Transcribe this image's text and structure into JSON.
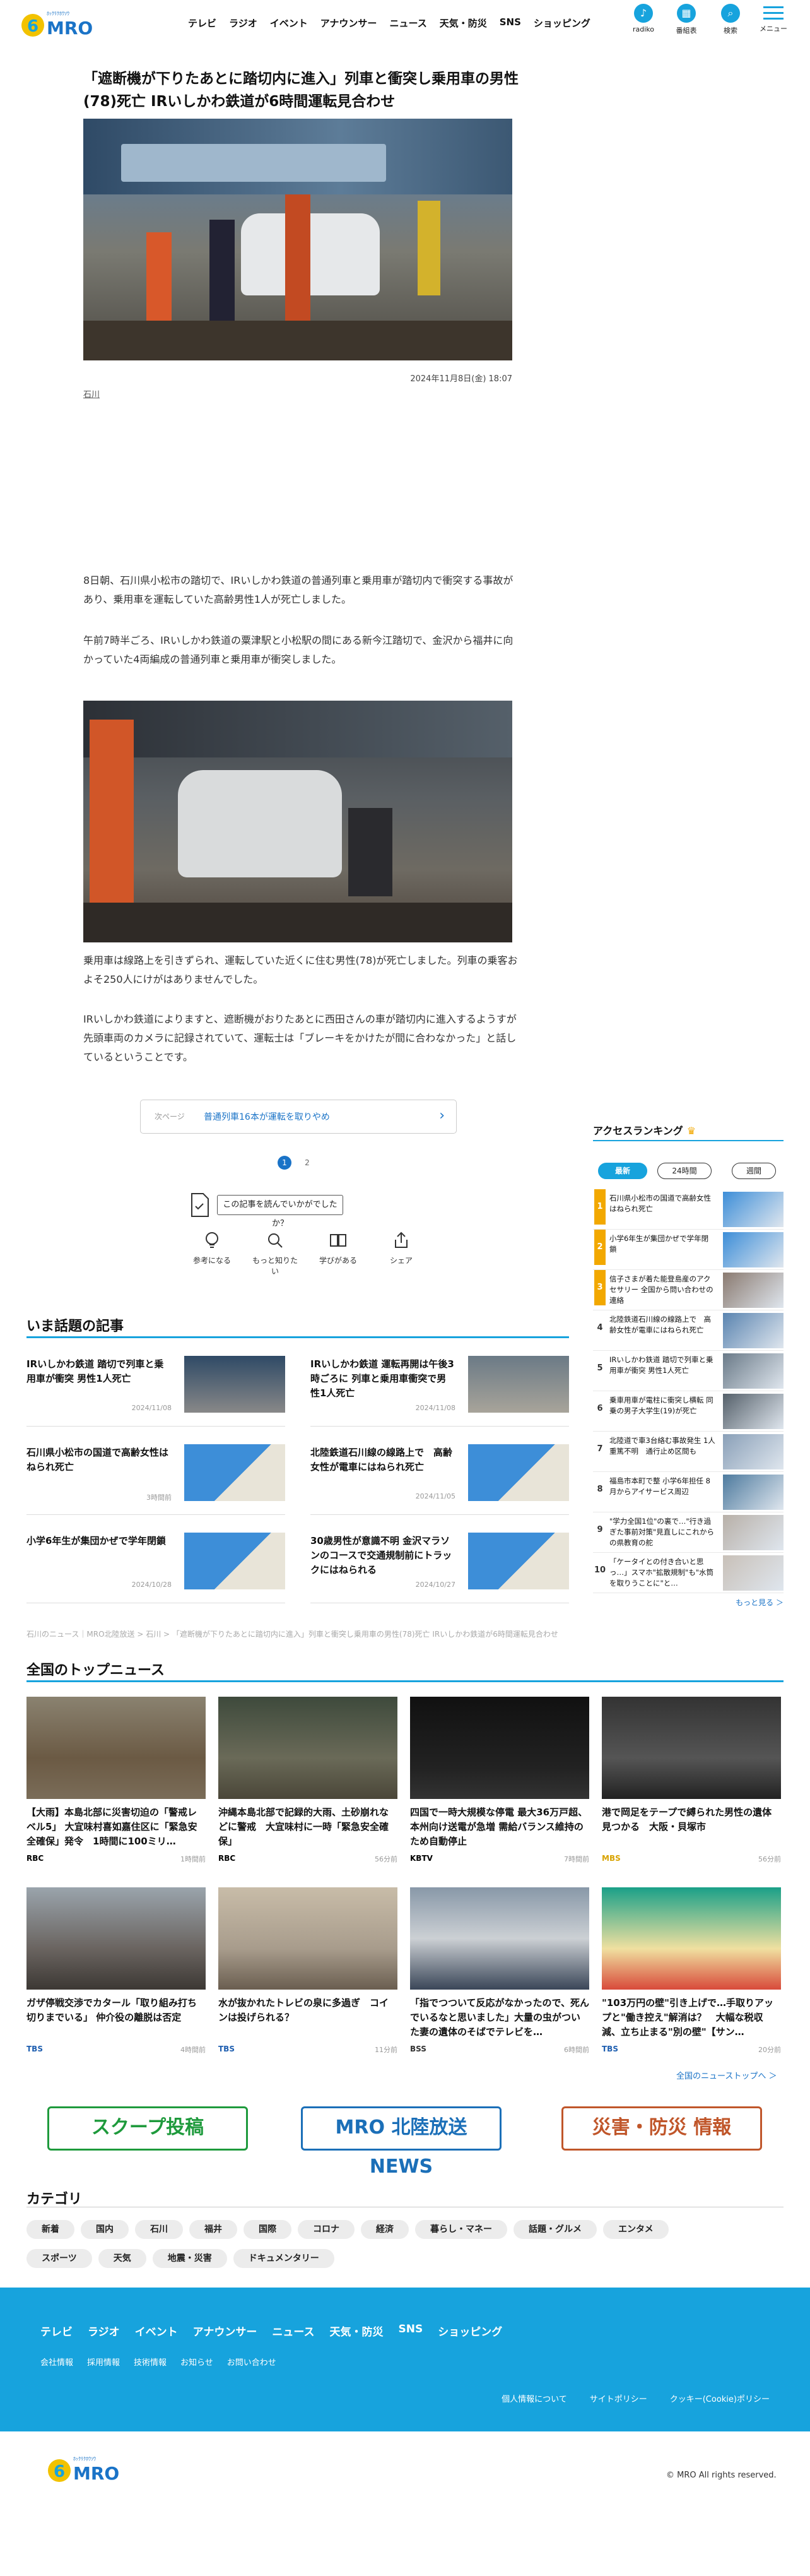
{
  "header": {
    "logo_text": "MRO",
    "logo_sub": "ﾎｯｸﾘｸﾎｳｿｳ",
    "nav": [
      "テレビ",
      "ラジオ",
      "イベント",
      "アナウンサー",
      "ニュース",
      "天気・防災",
      "SNS",
      "ショッピング"
    ],
    "icons": [
      {
        "label": "radiko",
        "icon": "radio-icon"
      },
      {
        "label": "番組表",
        "icon": "calendar-icon"
      },
      {
        "label": "検索",
        "icon": "search-icon"
      },
      {
        "label": "メニュー",
        "icon": "menu-icon"
      }
    ]
  },
  "article": {
    "title": "「遮断機が下りたあとに踏切内に進入」列車と衝突し乗用車の男性(78)死亡 IRいしかわ鉄道が6時間運転見合わせ",
    "date": "2024年11月8日(金) 18:07",
    "tag": "石川",
    "paragraphs": [
      "8日朝、石川県小松市の踏切で、IRいしかわ鉄道の普通列車と乗用車が踏切内で衝突する事故があり、乗用車を運転していた高齢男性1人が死亡しました。",
      "午前7時半ごろ、IRいしかわ鉄道の粟津駅と小松駅の間にある新今江踏切で、金沢から福井に向かっていた4両編成の普通列車と乗用車が衝突しました。",
      "乗用車は線路上を引きずられ、運転していた近くに住む男性(78)が死亡しました。列車の乗客およそ250人にけがはありませんでした。",
      "IRいしかわ鉄道によりますと、遮断機がおりたあとに西田さんの車が踏切内に進入するようすが先頭車両のカメラに記録されていて、運転士は「ブレーキをかけたが間に合わなかった」と話しているということです。"
    ],
    "prev_label": "次ページ",
    "prev_title": "普通列車16本が運転を取りやめ",
    "pages": [
      "1",
      "2"
    ],
    "ask": "この記事を読んでいかがでしたか？",
    "reactions": [
      {
        "label": "参考になる",
        "icon": "lightbulb-icon"
      },
      {
        "label": "もっと知りたい",
        "icon": "search-icon"
      },
      {
        "label": "学びがある",
        "icon": "book-icon"
      },
      {
        "label": "シェア",
        "icon": "share-icon"
      }
    ]
  },
  "ranking": {
    "title": "アクセスランキング",
    "tabs": [
      "最新",
      "24時間",
      "週間"
    ],
    "items": [
      {
        "n": "1",
        "title": "石川県小松市の国道で高齢女性はねられ死亡"
      },
      {
        "n": "2",
        "title": "小学6年生が集団かぜで学年閉鎖"
      },
      {
        "n": "3",
        "title": "信子さまが着た能登島産のアクセサリー 全国から問い合わせの連絡"
      },
      {
        "n": "4",
        "title": "北陸鉄道石川線の線路上で　高齢女性が電車にはねられ死亡"
      },
      {
        "n": "5",
        "title": "IRいしかわ鉄道 踏切で列車と乗用車が衝突 男性1人死亡"
      },
      {
        "n": "6",
        "title": "乗車用車が電柱に衝突し横転 同乗の男子大学生(19)が死亡"
      },
      {
        "n": "7",
        "title": "北陸道で車3台絡む事故発生 1人重篤不明　通行止め区間も"
      },
      {
        "n": "8",
        "title": "福島市本町で整 小学6年担任 8月からアイサービス周辺"
      },
      {
        "n": "9",
        "title": "\"学力全国1位\"の裏で…\"行き過ぎた事前対策\"見直しにこれからの県教育の舵"
      },
      {
        "n": "10",
        "title": "「ケータイとの付き合いと思っ…」スマホ\"拡散規制\"も\"水筒を取りうことに\"と…"
      }
    ],
    "more": "もっと見る ＞"
  },
  "topics": {
    "title": "いま話題の記事",
    "items": [
      {
        "title": "IRいしかわ鉄道 踏切で列車と乗用車が衝突 男性1人死亡",
        "date": "2024/11/08"
      },
      {
        "title": "IRいしかわ鉄道 運転再開は午後3時ごろに 列車と乗用車衝突で男性1人死亡",
        "date": "2024/11/08"
      },
      {
        "title": "石川県小松市の国道で高齢女性はねられ死亡",
        "date": "3時間前"
      },
      {
        "title": "北陸鉄道石川線の線路上で　高齢女性が電車にはねられ死亡",
        "date": "2024/11/05"
      },
      {
        "title": "小学6年生が集団かぜで学年閉鎖",
        "date": "2024/10/28"
      },
      {
        "title": "30歳男性が意識不明 金沢マラソンのコースで交通規制前にトラックにはねられる",
        "date": "2024/10/27"
      }
    ]
  },
  "breadcrumb": "石川のニュース｜MRO北陸放送 > 石川 > 「遮断機が下りたあとに踏切内に進入」列車と衝突し乗用車の男性(78)死亡 IRいしかわ鉄道が6時間運転見合わせ",
  "national": {
    "title": "全国のトップニュース",
    "items": [
      {
        "title": "【大雨】本島北部に災害切迫の「警戒レベル5」 大宜味村喜如嘉住区に「緊急安全確保」発令　1時間に100ミリ…",
        "src": "RBC",
        "date": "1時間前",
        "src_color": "#000"
      },
      {
        "title": "沖縄本島北部で記録的大雨、土砂崩れなどに警戒　大宜味村に一時「緊急安全確保」",
        "src": "RBC",
        "date": "56分前",
        "src_color": "#000"
      },
      {
        "title": "四国で一時大規模な停電 最大36万戸超、本州向け送電が急増 需給バランス維持のため自動停止",
        "src": "KBTV",
        "date": "7時間前",
        "src_color": "#000"
      },
      {
        "title": "港で岡足をテープで縛られた男性の遺体見つかる　大阪・貝塚市",
        "src": "MBS",
        "date": "56分前",
        "src_color": "#d8a300"
      },
      {
        "title": "ガザ停戦交渉でカタール「取り組み打ち切りまでいる」 仲介役の離脱は否定",
        "src": "TBS",
        "date": "4時間前",
        "src_color": "#1f5fb0"
      },
      {
        "title": "水が抜かれたトレビの泉に多過ぎ　コインは投げられる？",
        "src": "TBS",
        "date": "11分前",
        "src_color": "#1f5fb0"
      },
      {
        "title": "「指でつついて反応がなかったので、死んでいるなと思いました」大量の虫がついた妻の遺体のそばでテレビを…",
        "src": "BSS",
        "date": "6時間前",
        "src_color": "#333"
      },
      {
        "title": "\"103万円の壁\"引き上げで…手取りアップと\"働き控え\"解消は？　大幅な税収減、立ち止まる\"別の壁\"【サン…",
        "src": "TBS",
        "date": "20分前",
        "src_color": "#1f5fb0"
      }
    ],
    "more": "全国のニューストップへ ＞"
  },
  "banners": [
    {
      "text": "スクープ投稿",
      "color": "#1e9a3c"
    },
    {
      "text": "MRO 北陸放送 NEWS",
      "color": "#1b6fb8"
    },
    {
      "text": "災害・防災 情報",
      "color": "#c0562a"
    }
  ],
  "categories": {
    "title": "カテゴリ",
    "items": [
      "新着",
      "国内",
      "石川",
      "福井",
      "国際",
      "コロナ",
      "経済",
      "暮らし・マネー",
      "話題・グルメ",
      "エンタメ",
      "スポーツ",
      "天気",
      "地震・災害",
      "ドキュメンタリー"
    ]
  },
  "footer": {
    "nav": [
      "テレビ",
      "ラジオ",
      "イベント",
      "アナウンサー",
      "ニュース",
      "天気・防災",
      "SNS",
      "ショッピング"
    ],
    "sub": [
      "会社情報",
      "採用情報",
      "技術情報",
      "お知らせ",
      "お問い合わせ"
    ],
    "policies": [
      "個人情報について",
      "サイトポリシー",
      "クッキー(Cookie)ポリシー"
    ],
    "copyright": "© MRO All rights reserved."
  }
}
